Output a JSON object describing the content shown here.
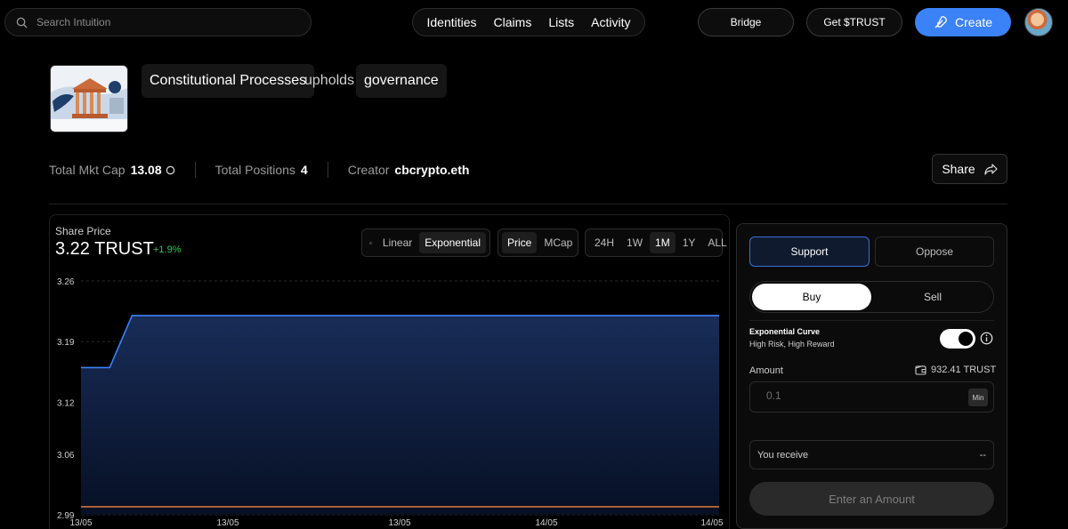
{
  "header": {
    "search_placeholder": "Search Intuition",
    "nav": [
      "Identities",
      "Claims",
      "Lists",
      "Activity"
    ],
    "bridge_label": "Bridge",
    "get_trust_label": "Get $TRUST",
    "create_label": "Create",
    "accent": "#3b82f6"
  },
  "triple": {
    "subject": "Constitutional Processes",
    "predicate": "upholds",
    "object": "governance"
  },
  "stats": {
    "mkt_cap_label": "Total Mkt Cap",
    "mkt_cap_value": "13.08",
    "positions_label": "Total Positions",
    "positions_value": "4",
    "creator_label": "Creator",
    "creator_value": "cbcrypto.eth",
    "share_label": "Share"
  },
  "chart_panel": {
    "label": "Share Price",
    "value": "3.22 TRUST",
    "change": "+1.9%",
    "change_color": "#34c759",
    "scale_options": [
      "Linear",
      "Exponential"
    ],
    "scale_selected": "Exponential",
    "metric_options": [
      "Price",
      "MCap"
    ],
    "metric_selected": "Price",
    "range_options": [
      "24H",
      "1W",
      "1M",
      "1Y",
      "ALL"
    ],
    "range_selected": "1M"
  },
  "chart_data": {
    "type": "area",
    "yticks": [
      3.26,
      3.19,
      3.12,
      3.06,
      2.99
    ],
    "xticks": [
      "13/05",
      "13/05",
      "13/05",
      "14/05",
      "14/05"
    ],
    "ylim": [
      2.99,
      3.26
    ],
    "x": [
      0,
      0.045,
      0.08,
      1.0
    ],
    "series": [
      {
        "values": [
          3.16,
          3.16,
          3.22,
          3.22
        ],
        "color": "#3b82f6"
      },
      {
        "values": [
          2.99,
          2.99,
          2.99,
          2.99
        ],
        "color": "#e07a3a"
      }
    ],
    "grid": true
  },
  "trade": {
    "support_label": "Support",
    "oppose_label": "Oppose",
    "buy_label": "Buy",
    "sell_label": "Sell",
    "curve_title": "Exponential Curve",
    "curve_subtitle": "High Risk, High Reward",
    "amount_label": "Amount",
    "balance": "932.41 TRUST",
    "amount_placeholder": "0.1",
    "min_label": "Min",
    "receive_label": "You receive",
    "receive_value": "--",
    "submit_label": "Enter an Amount"
  }
}
